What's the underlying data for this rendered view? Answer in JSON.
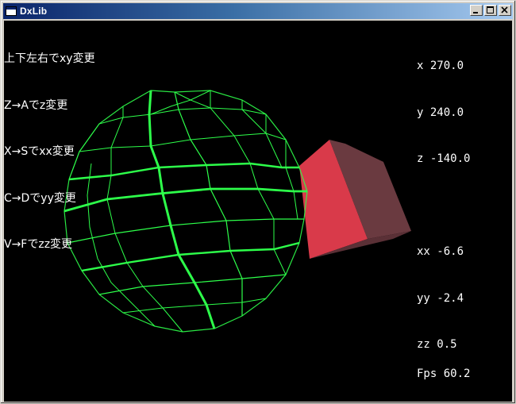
{
  "window": {
    "title": "DxLib",
    "buttons": {
      "minimize": "_",
      "maximize": "□",
      "close": "×"
    }
  },
  "help_lines": [
    "上下左右でxy変更",
    "Z→Aでz変更",
    "X→Sでxx変更",
    "C→Dでyy変更",
    "V→Fでzz変更"
  ],
  "position": {
    "x": "x 270.0",
    "y": "y 240.0",
    "z": "z -140.0"
  },
  "rotation": {
    "xx": "xx -6.6",
    "yy": "yy -2.4",
    "zz": "zz 0.5"
  },
  "fps": "Fps 60.2",
  "colors": {
    "background": "#000000",
    "sphere_wire": "#2dff4a",
    "cube_front": "#d93a4a",
    "cube_side": "#6a3a40",
    "titlebar_start": "#0a246a",
    "titlebar_end": "#a6caf0"
  }
}
